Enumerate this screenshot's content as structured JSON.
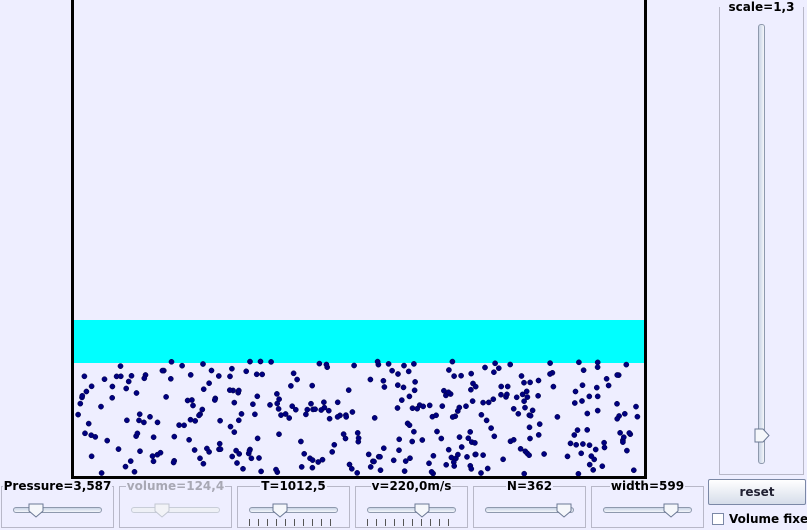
{
  "simulation": {
    "particle_count": 362,
    "particle_color": "#000080",
    "piston_color": "#00ffff",
    "background_color": "#eeeeff"
  },
  "scale": {
    "label": "scale=1,3",
    "level": 0.05
  },
  "controls": [
    {
      "name": "pressure",
      "label": "Pressure=3,587",
      "level": 0.2,
      "enabled": true,
      "ticks": false
    },
    {
      "name": "volume",
      "label": "volume=124,4",
      "level": 0.3,
      "enabled": false,
      "ticks": false
    },
    {
      "name": "temperature",
      "label": "T=1012,5",
      "level": 0.3,
      "enabled": true,
      "ticks": true
    },
    {
      "name": "velocity",
      "label": "v=220,0m/s",
      "level": 0.62,
      "enabled": true,
      "ticks": true
    },
    {
      "name": "n",
      "label": "N=362",
      "level": 0.95,
      "enabled": true,
      "ticks": false
    },
    {
      "name": "width",
      "label": "width=599",
      "level": 0.8,
      "enabled": true,
      "ticks": false
    }
  ],
  "reset_label": "reset",
  "volume_fixed": {
    "label": "Volume fixed",
    "checked": false
  }
}
